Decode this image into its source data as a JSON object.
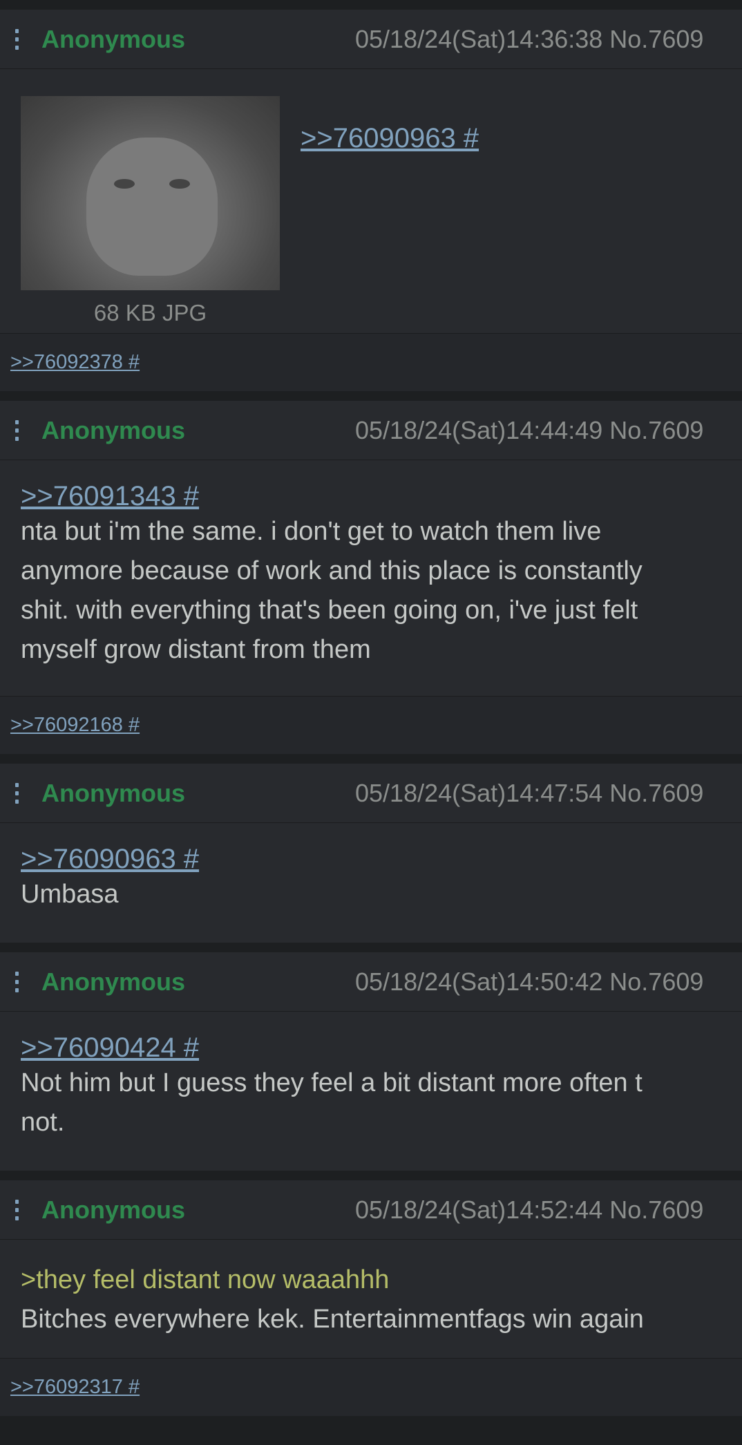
{
  "posts": [
    {
      "name": "Anonymous",
      "stamp": "05/18/24(Sat)14:36:38 No.7609",
      "quote": ">>76090963 #",
      "file_info": "68 KB JPG",
      "replies": ">>76092378 #"
    },
    {
      "name": "Anonymous",
      "stamp": "05/18/24(Sat)14:44:49 No.7609",
      "quote": ">>76091343 #",
      "lines": [
        "nta but i'm the same. i don't get to watch them live",
        "anymore because of work and this place is constantly",
        "shit. with everything that's been going on, i've just felt",
        "myself grow distant from them"
      ],
      "replies": ">>76092168 #"
    },
    {
      "name": "Anonymous",
      "stamp": "05/18/24(Sat)14:47:54 No.7609",
      "quote": ">>76090963 #",
      "lines": [
        "Umbasa"
      ]
    },
    {
      "name": "Anonymous",
      "stamp": "05/18/24(Sat)14:50:42 No.7609",
      "quote": ">>76090424 #",
      "lines": [
        "Not him but I guess they feel a bit distant more often t",
        "not."
      ]
    },
    {
      "name": "Anonymous",
      "stamp": "05/18/24(Sat)14:52:44 No.7609",
      "greentext": ">they feel distant now waaahhh",
      "lines": [
        "Bitches everywhere kek. Entertainmentfags win again"
      ],
      "replies": ">>76092317 #"
    }
  ],
  "colors": {
    "name": "#2f8a4f",
    "link": "#81a2be",
    "greentext": "#b5bd68"
  }
}
